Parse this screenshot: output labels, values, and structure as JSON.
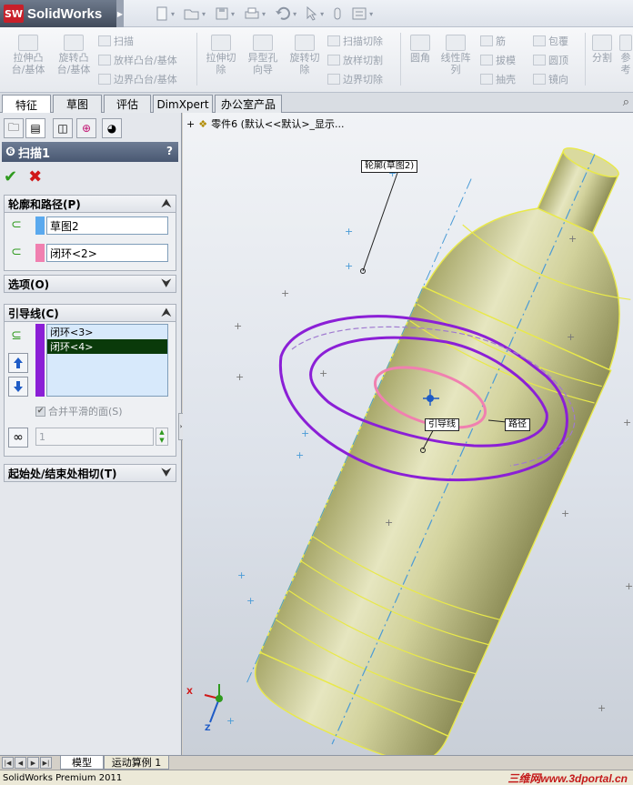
{
  "app": {
    "name": "SolidWorks",
    "logo_mark": "SW"
  },
  "commands": {
    "extrude_boss": "拉伸凸台/基体",
    "revolve_boss": "旋转凸台/基体",
    "sweep": "扫描",
    "loft_boss": "放样凸台/基体",
    "boundary_boss": "边界凸台/基体",
    "extrude_cut": "拉伸切除",
    "hole_wizard": "异型孔向导",
    "revolve_cut": "旋转切除",
    "sweep_cut": "扫描切除",
    "loft_cut": "放样切割",
    "boundary_cut": "边界切除",
    "fillet": "圆角",
    "linear_pattern": "线性阵列",
    "rib": "筋",
    "draft": "拔模",
    "shell": "抽壳",
    "wrap": "包覆",
    "dome": "圆顶",
    "mirror": "镜向",
    "split": "分割",
    "reference": "参考"
  },
  "tabs": [
    "特征",
    "草图",
    "评估",
    "DimXpert",
    "办公室产品"
  ],
  "active_tab": "特征",
  "pm": {
    "title": "扫描1",
    "help": "?",
    "ok": "✔",
    "cancel": "✖",
    "profile_path": {
      "header": "轮廓和路径(P)",
      "profile": "草图2",
      "path": "闭环<2>",
      "profile_color": "#5aa9ee",
      "path_color": "#f080b0"
    },
    "options": {
      "header": "选项(O)"
    },
    "guides": {
      "header": "引导线(C)",
      "items": [
        "闭环<3>",
        "闭环<4>"
      ],
      "merge_faces": "合并平滑的面(S)",
      "merge_checked": "✔",
      "count": "1",
      "bar_color": "#8b1fd6"
    },
    "tangency": {
      "header": "起始处/结束处相切(T)"
    }
  },
  "viewport": {
    "tree_label": "零件6 (默认<<默认>_显示...",
    "callouts": {
      "profile": "轮廓(草图2)",
      "guide": "引导线",
      "path": "路径"
    },
    "axis_x": "X",
    "axis_z": "Z"
  },
  "bottom_tabs": [
    "模型",
    "运动算例 1"
  ],
  "status": "SolidWorks Premium 2011",
  "watermark": "三维网www.3dportal.cn"
}
